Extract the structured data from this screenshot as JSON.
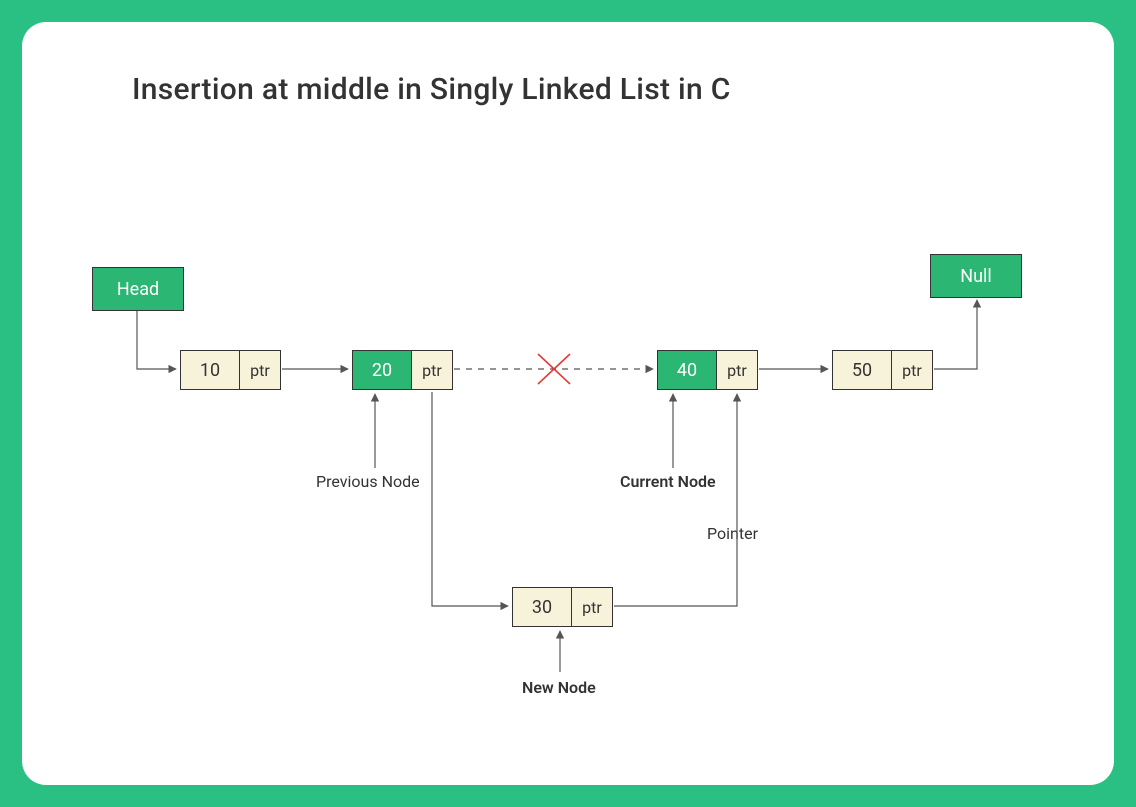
{
  "title": "Insertion at middle in Singly Linked List in C",
  "head_label": "Head",
  "null_label": "Null",
  "ptr_text": "ptr",
  "nodes": {
    "n10": {
      "value": "10"
    },
    "n20": {
      "value": "20"
    },
    "n30": {
      "value": "30"
    },
    "n40": {
      "value": "40"
    },
    "n50": {
      "value": "50"
    }
  },
  "labels": {
    "previous": "Previous Node",
    "current": "Current Node",
    "newnode": "New Node",
    "pointer": "Pointer"
  },
  "diagram_intent": "A singly linked list 10->20->40->50->Null with the old link 20->40 crossed out; a new node 30 is being inserted between 20 and 40 (20->30->40). 20 is labeled Previous Node, 40 is labeled Current Node, 30 is New Node; the arrow from 30's ptr to 40 is labeled Pointer.",
  "colors": {
    "brand": "#2bc083",
    "node_fill": "#f7f3db",
    "highlight": "#2bb673",
    "cross": "#e53935"
  }
}
